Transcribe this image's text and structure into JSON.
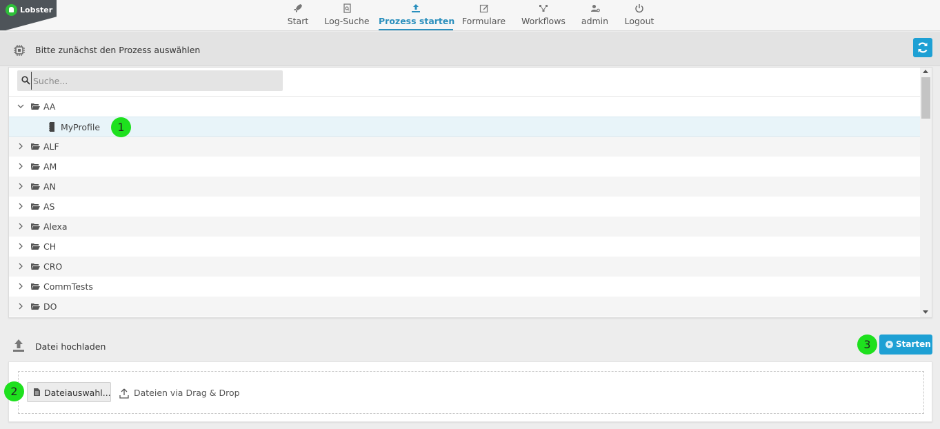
{
  "app": {
    "logo_text": "Lobster"
  },
  "nav": {
    "items": [
      {
        "label": "Start",
        "icon": "rocket-icon",
        "active": false
      },
      {
        "label": "Log-Suche",
        "icon": "log-search-icon",
        "active": false
      },
      {
        "label": "Prozess starten",
        "icon": "upload-icon",
        "active": true
      },
      {
        "label": "Formulare",
        "icon": "edit-form-icon",
        "active": false
      },
      {
        "label": "Workflows",
        "icon": "workflow-icon",
        "active": false
      },
      {
        "label": "admin",
        "icon": "user-settings-icon",
        "active": false
      },
      {
        "label": "Logout",
        "icon": "power-icon",
        "active": false
      }
    ]
  },
  "process": {
    "title": "Bitte zunächst den Prozess auswählen",
    "refresh_icon": "refresh-icon"
  },
  "tree": {
    "search_placeholder": "Suche...",
    "expanded_folder": "AA",
    "selected_child": "MyProfile",
    "folders": [
      "ALF",
      "AM",
      "AN",
      "AS",
      "Alexa",
      "CH",
      "CRO",
      "CommTests",
      "DO"
    ]
  },
  "markers": {
    "m1": "1",
    "m2": "2",
    "m3": "3"
  },
  "upload": {
    "title": "Datei hochladen",
    "start_label": "Starten",
    "file_button_label": "Dateiauswahl...",
    "dragdrop_text": "Dateien via Drag & Drop"
  },
  "colors": {
    "accent": "#1ea0d4",
    "nav_active": "#2a8fbd",
    "marker": "#1ee01e"
  }
}
